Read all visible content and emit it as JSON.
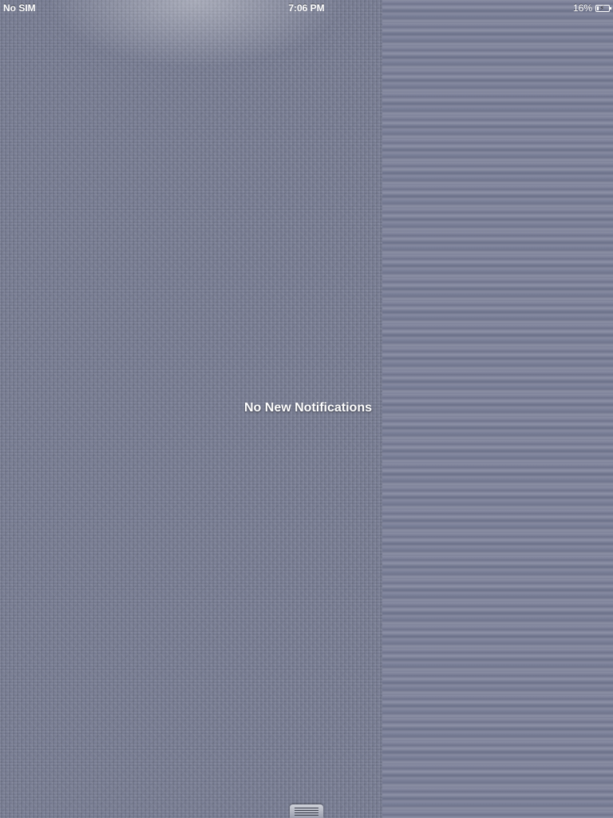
{
  "status_bar": {
    "carrier": "No SIM",
    "time": "7:06 PM",
    "battery_percent": "16%",
    "battery_level": 0.16,
    "battery_icon": "battery-charging-icon"
  },
  "notification_center": {
    "empty_message": "No New Notifications",
    "handle_icon": "grabber-handle-icon"
  },
  "colors": {
    "linen_background": "#7b8096",
    "stripe_background": "#7a7f96",
    "text": "#ffffff"
  }
}
